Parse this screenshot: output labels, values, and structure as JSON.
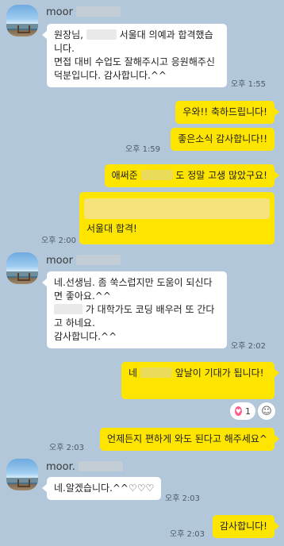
{
  "messages": {
    "group1": {
      "sender_name": "moor",
      "text_a": "원장님,",
      "text_b": " 서울대 의예과 합격했습니다.\n면접 대비 수업도 잘해주시고 응원해주신 덕분입니다. 감사합니다.^^",
      "time": "오후 1:55"
    },
    "out1": {
      "text": "우와!! 축하드립니다!"
    },
    "out2": {
      "text": "좋은소식 감사합니다!!",
      "time": "오후 1:59"
    },
    "out3": {
      "text_a": "애써준",
      "text_b": "도 정말 고생 많았구요!"
    },
    "out4": {
      "text": "서울대 합격!",
      "time": "오후 2:00"
    },
    "group2": {
      "sender_name": "moor",
      "text_a": "네.선생님. 좀 쑥스럽지만 도움이 되신다면 좋아요.^^",
      "text_b": "가 대학가도 코딩 배우러 또 간다고 하네요.\n감사합니다.^^",
      "time": "오후 2:02"
    },
    "out5": {
      "text_a": "네",
      "text_b": "앞날이 기대가 됩니다!"
    },
    "reaction": {
      "icon": "heart-icon",
      "count": "1",
      "color": "#ff5c8a"
    },
    "out6": {
      "text": "언제든지 편하게 와도 된다고 해주세요^",
      "time": "오후 2:03"
    },
    "group3": {
      "sender_name": "moor.",
      "text": "네.알겠습니다.^^♡♡♡",
      "time": "오후 2:03"
    },
    "out7": {
      "text": "감사합니다!",
      "time": "오후 2:03"
    }
  },
  "colors": {
    "background": "#b2c7d9",
    "outgoing_bubble": "#fee500",
    "incoming_bubble": "#ffffff"
  }
}
